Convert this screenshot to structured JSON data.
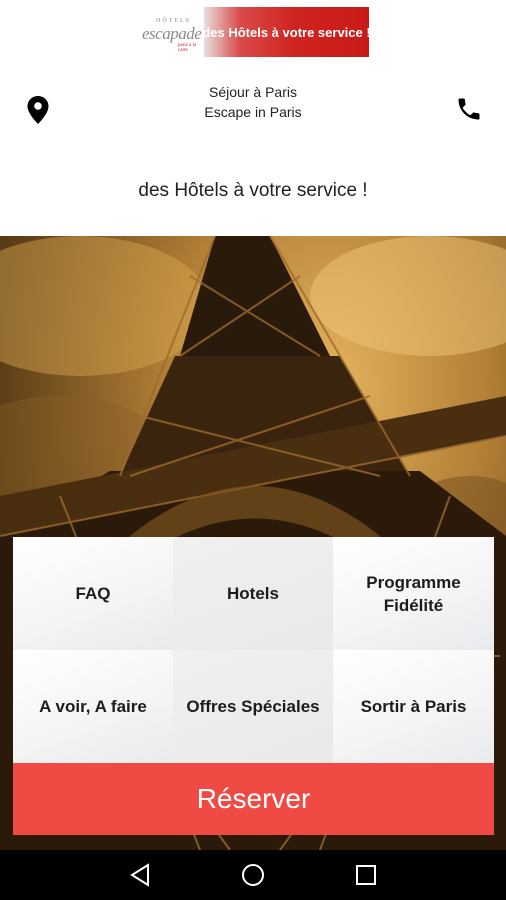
{
  "logo": {
    "small": "HÔTELS",
    "main": "escapade",
    "sub": "paris à la carte",
    "banner": "des Hôtels à votre service !"
  },
  "header": {
    "line1": "Séjour à Paris",
    "line2": "Escape in Paris",
    "left_icon": "location-pin-icon",
    "right_icon": "phone-icon"
  },
  "tagline": "des Hôtels à votre service !",
  "menu": {
    "faq": "FAQ",
    "hotels": "Hotels",
    "fidelite": "Programme Fidélité",
    "a_voir": "A voir, A faire",
    "offres": "Offres Spéciales",
    "sortir": "Sortir à Paris"
  },
  "reserve_label": "Réserver",
  "colors": {
    "accent": "#f04a44",
    "brand_red": "#d02420",
    "navbar": "#000000"
  },
  "navbar": {
    "icons": [
      "back-icon",
      "home-icon",
      "recents-icon"
    ]
  }
}
